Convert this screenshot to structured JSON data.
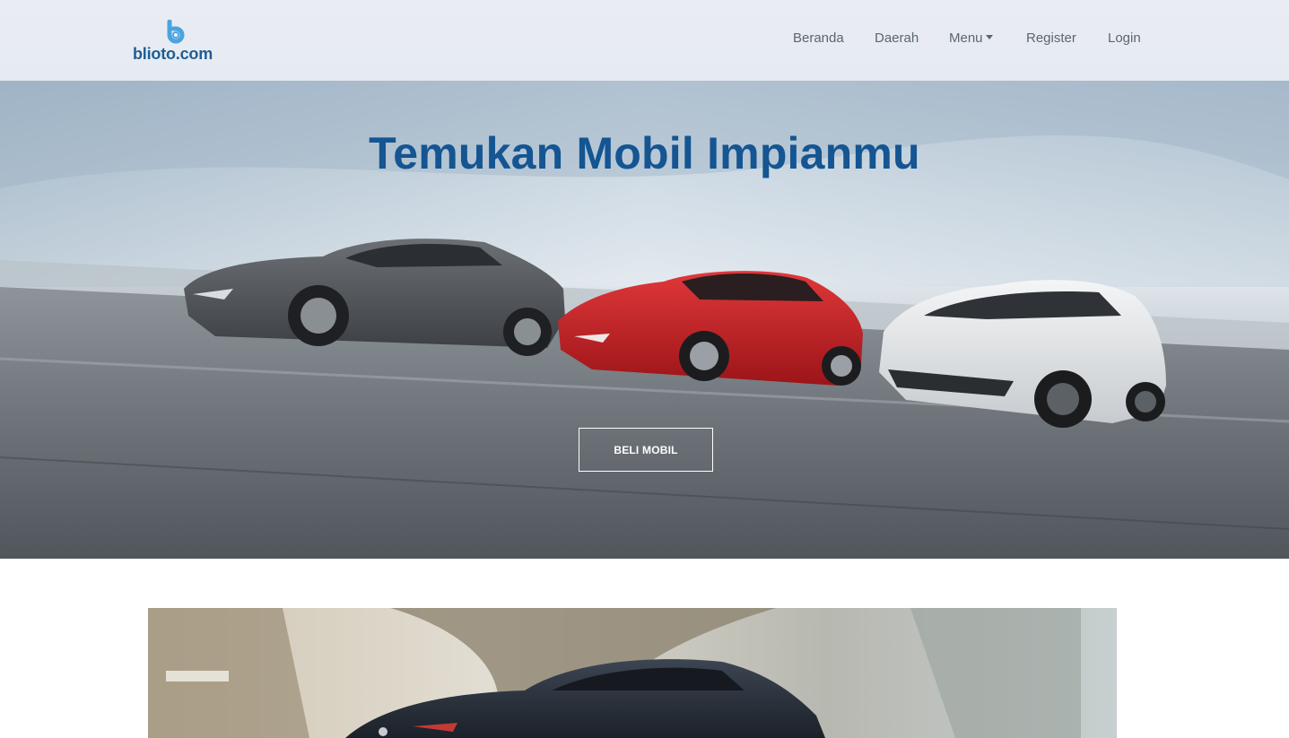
{
  "brand": {
    "name": "blioto.com",
    "logo_icon": "blioto-logo-mark",
    "colors": {
      "logo_text": "#1f5d96",
      "logo_mark": "#4aa3e0"
    }
  },
  "nav": {
    "items": [
      {
        "label": "Beranda",
        "name": "nav-beranda"
      },
      {
        "label": "Daerah",
        "name": "nav-daerah"
      },
      {
        "label": "Menu",
        "name": "nav-menu",
        "dropdown": true
      },
      {
        "label": "Register",
        "name": "nav-register"
      },
      {
        "label": "Login",
        "name": "nav-login"
      }
    ],
    "colors": {
      "text": "#5b6670",
      "background": "#e8ecf2"
    }
  },
  "hero": {
    "title": "Temukan Mobil Impianmu",
    "cta_label": "BELI MOBIL",
    "image": "three-cars-on-highway",
    "colors": {
      "title": "#145592",
      "cta_border": "#ffffff"
    }
  },
  "feature": {
    "image": "dark-sedan-under-bridge"
  }
}
